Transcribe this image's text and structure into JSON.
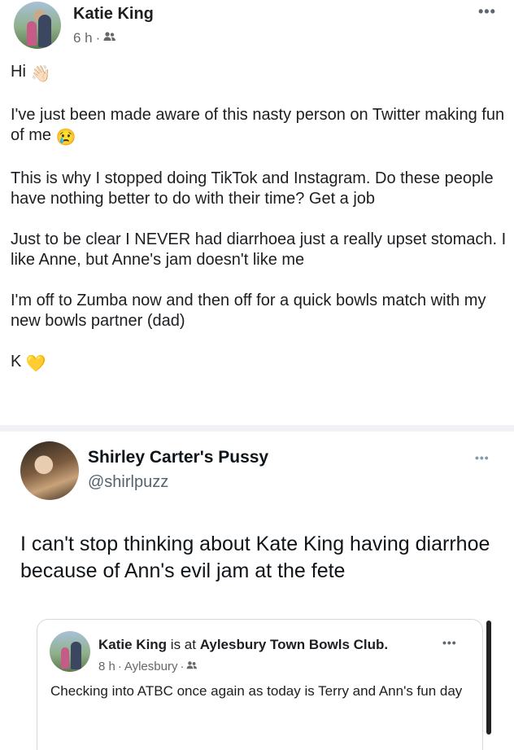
{
  "fb_post": {
    "author": "Katie King",
    "time": "6 h",
    "separator": "·",
    "audience_icon": "friends-icon",
    "more_icon": "•••",
    "greeting": "Hi",
    "greeting_emoji": "👋🏻",
    "line1": "I've just been made aware of this nasty person on Twitter making fun of me",
    "line1_emoji": "😢",
    "line2": "This is why I stopped doing TikTok and Instagram. Do these people have nothing better to do with their time? Get a job",
    "line3": "Just to be clear I NEVER had diarrhoea just a really upset stomach. I like Anne, but Anne's jam doesn't like me",
    "line4": "I'm off to Zumba now and then off for a quick bowls match with my new bowls partner (dad)",
    "signoff": "K",
    "signoff_emoji": "💛"
  },
  "tweet": {
    "name": "Shirley Carter's Pussy",
    "handle": "@shirlpuzz",
    "more_icon": "•••",
    "text": "I can't stop thinking about Kate King having diarrhoe because of Ann's evil jam at the fete",
    "quoted": {
      "author": "Katie King",
      "is_at": "is at",
      "place": "Aylesbury Town Bowls Club.",
      "time": "8 h",
      "location": "Aylesbury",
      "separator": "·",
      "more_icon": "•••",
      "text": "Checking into ATBC once again as today is Terry and Ann's fun day"
    }
  }
}
